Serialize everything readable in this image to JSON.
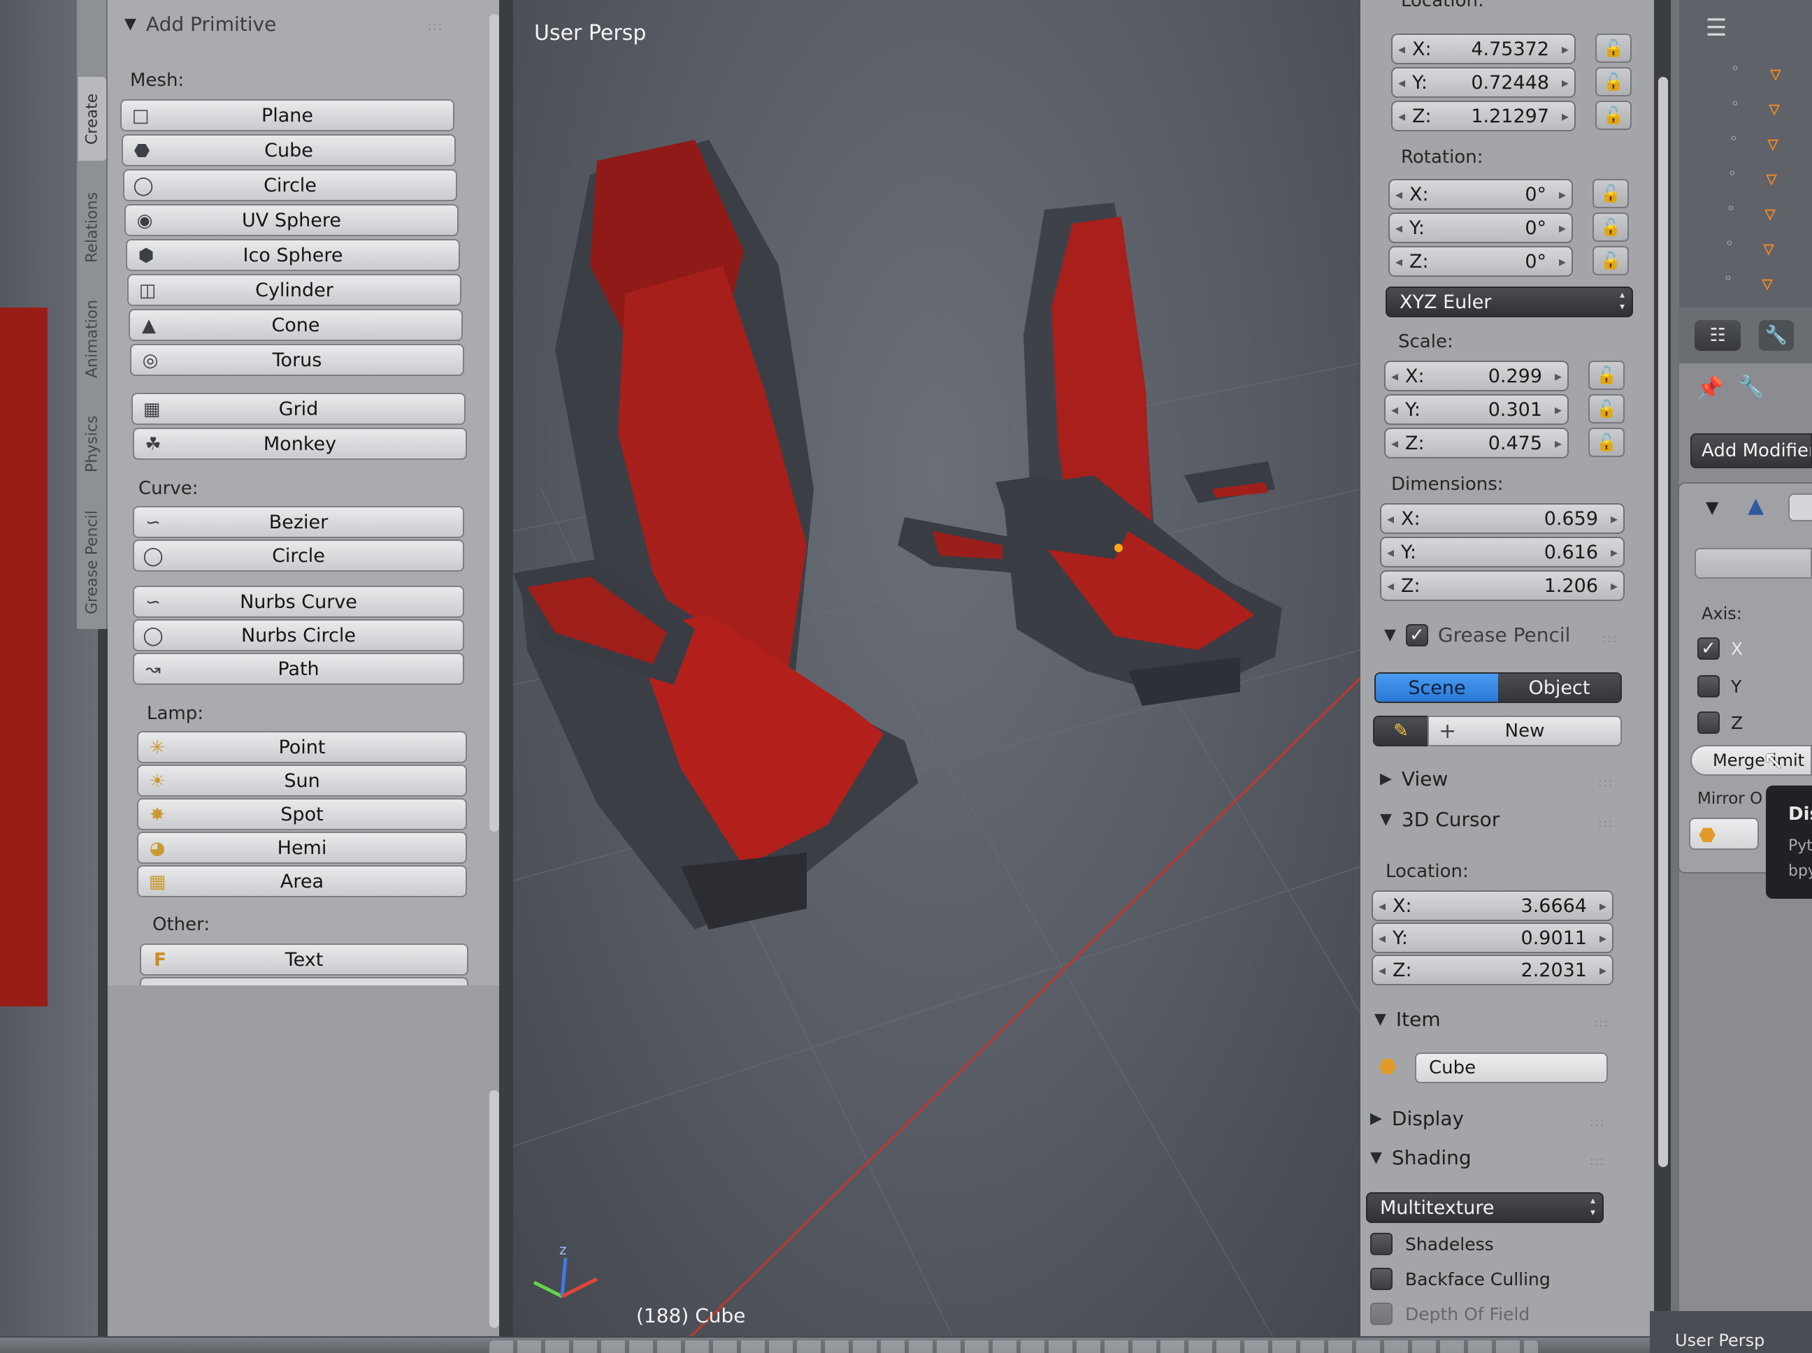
{
  "toolshelf": {
    "title": "Add Primitive",
    "tabs": [
      "Create",
      "Relations",
      "Animation",
      "Physics",
      "Grease Pencil"
    ],
    "mesh_header": "Mesh:",
    "mesh_items": [
      "Plane",
      "Cube",
      "Circle",
      "UV Sphere",
      "Ico Sphere",
      "Cylinder",
      "Cone",
      "Torus"
    ],
    "mesh_items2": [
      "Grid",
      "Monkey"
    ],
    "curve_header": "Curve:",
    "curve_items": [
      "Bezier",
      "Circle"
    ],
    "curve_items2": [
      "Nurbs Curve",
      "Nurbs Circle",
      "Path"
    ],
    "lamp_header": "Lamp:",
    "lamp_items": [
      "Point",
      "Sun",
      "Spot",
      "Hemi",
      "Area"
    ],
    "other_header": "Other:",
    "other_items": [
      "Text"
    ]
  },
  "viewport": {
    "view_label": "User Persp",
    "object_label": "(188) Cube",
    "seat_color": "#b3201c",
    "frame_color": "#4d4f58"
  },
  "properties": {
    "location": {
      "label": "Location:",
      "x": "4.75372",
      "y": "0.72448",
      "z": "1.21297"
    },
    "rotation": {
      "label": "Rotation:",
      "x": "0°",
      "y": "0°",
      "z": "0°"
    },
    "rotation_mode": "XYZ Euler",
    "scale": {
      "label": "Scale:",
      "x": "0.299",
      "y": "0.301",
      "z": "0.475"
    },
    "dimensions": {
      "label": "Dimensions:",
      "x": "0.659",
      "y": "0.616",
      "z": "1.206"
    },
    "axis_labels": {
      "x": "X:",
      "y": "Y:",
      "z": "Z:"
    },
    "grease_pencil": {
      "title": "Grease Pencil",
      "scene": "Scene",
      "object": "Object",
      "new": "New"
    },
    "view": "View",
    "cursor": {
      "title": "3D Cursor",
      "label": "Location:",
      "x": "3.6664",
      "y": "0.9011",
      "z": "2.2031"
    },
    "item": {
      "title": "Item",
      "name": "Cube"
    },
    "display": "Display",
    "shading": {
      "title": "Shading",
      "mode": "Multitexture",
      "shadeless": "Shadeless",
      "backface": "Backface Culling",
      "dof": "Depth Of Field"
    }
  },
  "modifier": {
    "add": "Add Modifier",
    "axis": "Axis:",
    "x": "X",
    "y": "Y",
    "z": "Z",
    "merge": "Merge",
    "limit_partial": "imit",
    "mirror": "Mirror O",
    "tooltip_title": "Dis",
    "tooltip_lines": [
      "Pyt",
      "bpy"
    ]
  },
  "bottom": {
    "view_label": "User Persp"
  },
  "colors": {
    "accent_blue": "#2f86e6",
    "panel": "#a9abaf",
    "viewport_bg": "#5b6068"
  }
}
